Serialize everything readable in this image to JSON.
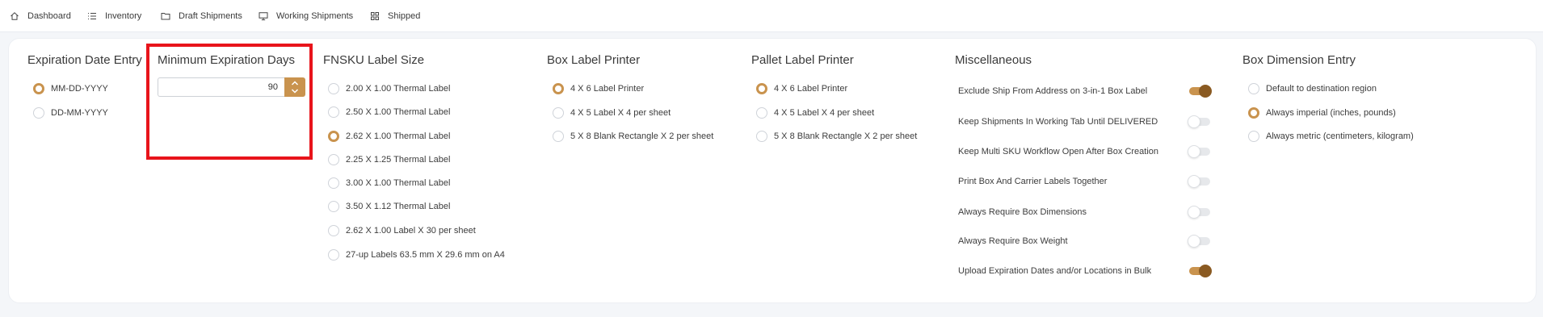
{
  "nav": {
    "items": [
      {
        "label": "Dashboard",
        "icon": "home-icon"
      },
      {
        "label": "Inventory",
        "icon": "list-icon"
      },
      {
        "label": "Draft Shipments",
        "icon": "folder-icon"
      },
      {
        "label": "Working Shipments",
        "icon": "monitor-icon"
      },
      {
        "label": "Shipped",
        "icon": "grid-icon"
      }
    ]
  },
  "expiration_date_entry": {
    "title": "Expiration Date Entry",
    "options": [
      {
        "label": "MM-DD-YYYY",
        "checked": true
      },
      {
        "label": "DD-MM-YYYY",
        "checked": false
      }
    ]
  },
  "minimum_expiration_days": {
    "title": "Minimum Expiration Days",
    "value": "90"
  },
  "fnsku_label_size": {
    "title": "FNSKU Label Size",
    "options": [
      {
        "label": "2.00 X 1.00 Thermal Label",
        "checked": false
      },
      {
        "label": "2.50 X 1.00 Thermal Label",
        "checked": false
      },
      {
        "label": "2.62 X 1.00 Thermal Label",
        "checked": true
      },
      {
        "label": "2.25 X 1.25 Thermal Label",
        "checked": false
      },
      {
        "label": "3.00 X 1.00 Thermal Label",
        "checked": false
      },
      {
        "label": "3.50 X 1.12 Thermal Label",
        "checked": false
      },
      {
        "label": "2.62 X 1.00 Label X 30 per sheet",
        "checked": false
      },
      {
        "label": "27-up Labels 63.5 mm X 29.6 mm on A4",
        "checked": false
      }
    ]
  },
  "box_label_printer": {
    "title": "Box Label Printer",
    "options": [
      {
        "label": "4 X 6 Label Printer",
        "checked": true
      },
      {
        "label": "4 X 5 Label X 4 per sheet",
        "checked": false
      },
      {
        "label": "5 X 8 Blank Rectangle X 2 per sheet",
        "checked": false
      }
    ]
  },
  "pallet_label_printer": {
    "title": "Pallet Label Printer",
    "options": [
      {
        "label": "4 X 6 Label Printer",
        "checked": true
      },
      {
        "label": "4 X 5 Label X 4 per sheet",
        "checked": false
      },
      {
        "label": "5 X 8 Blank Rectangle X 2 per sheet",
        "checked": false
      }
    ]
  },
  "miscellaneous": {
    "title": "Miscellaneous",
    "toggles": [
      {
        "label": "Exclude Ship From Address on 3-in-1 Box Label",
        "on": true
      },
      {
        "label": "Keep Shipments In Working Tab Until DELIVERED",
        "on": false
      },
      {
        "label": "Keep Multi SKU Workflow Open After Box Creation",
        "on": false
      },
      {
        "label": "Print Box And Carrier Labels Together",
        "on": false
      },
      {
        "label": "Always Require Box Dimensions",
        "on": false
      },
      {
        "label": "Always Require Box Weight",
        "on": false
      },
      {
        "label": "Upload Expiration Dates and/or Locations in Bulk",
        "on": true
      }
    ]
  },
  "box_dimension_entry": {
    "title": "Box Dimension Entry",
    "options": [
      {
        "label": "Default to destination region",
        "checked": false
      },
      {
        "label": "Always imperial (inches, pounds)",
        "checked": true
      },
      {
        "label": "Always metric (centimeters, kilogram)",
        "checked": false
      }
    ]
  },
  "colors": {
    "accent": "#c9934e",
    "toggle_knob_on": "#8a5a22",
    "highlight": "#e8141b"
  }
}
